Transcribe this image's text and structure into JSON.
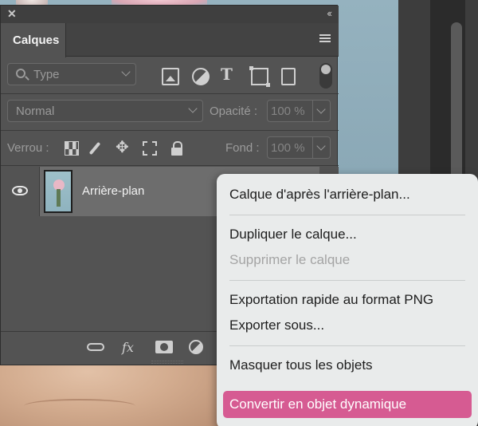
{
  "panel": {
    "close_glyph": "✕",
    "collapse_glyph": "‹‹",
    "tab_label": "Calques",
    "menu_icon": "hamburger-icon",
    "filter": {
      "type_placeholder": "Type",
      "icons": [
        "image-filter-icon",
        "adjustment-filter-icon",
        "text-filter-icon",
        "shape-filter-icon",
        "smart-object-filter-icon"
      ]
    },
    "blend_mode": "Normal",
    "opacity_label": "Opacité :",
    "opacity_value": "100 %",
    "lock_label": "Verrou :",
    "lock_icons": [
      "lock-pixels-icon",
      "lock-paint-icon",
      "lock-position-icon",
      "lock-artboard-icon",
      "lock-all-icon"
    ],
    "fill_label": "Fond :",
    "fill_value": "100 %",
    "layers": [
      {
        "name": "Arrière-plan",
        "visible": true,
        "selected": true
      }
    ],
    "bottom_icons": [
      "link-icon",
      "fx-icon",
      "mask-icon",
      "adjustment-layer-icon"
    ],
    "fx_label": "fx"
  },
  "context_menu": {
    "items": [
      {
        "label": "Calque d'après l'arrière-plan...",
        "disabled": false
      },
      {
        "label": "Dupliquer le calque...",
        "disabled": false
      },
      {
        "label": "Supprimer le calque",
        "disabled": true
      },
      {
        "label": "Exportation rapide au format PNG",
        "disabled": false
      },
      {
        "label": "Exporter sous...",
        "disabled": false
      },
      {
        "label": "Masquer tous les objets",
        "disabled": false
      },
      {
        "label": "Convertir en objet dynamique",
        "disabled": false,
        "highlighted": true
      }
    ],
    "highlight_color": "#d65b92"
  },
  "colors": {
    "panel_bg": "#535353",
    "selected_layer_bg": "#6d6d6d",
    "menu_bg": "#e9ebeb"
  }
}
